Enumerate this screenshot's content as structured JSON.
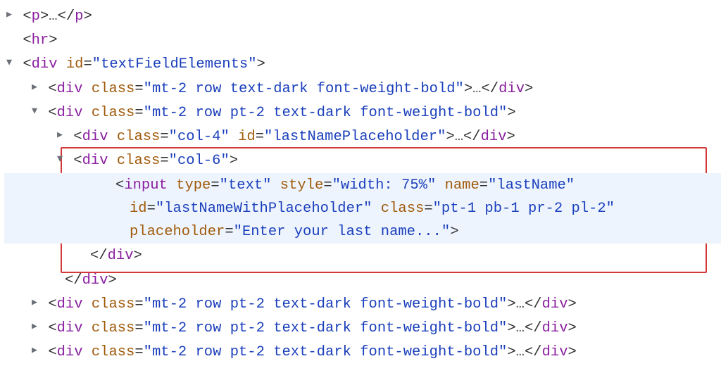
{
  "glyphs": {
    "right": "▸",
    "down": "▾",
    "ellipsis": "…"
  },
  "punct": {
    "lt": "<",
    "gt": ">",
    "close": "</",
    "eq": "="
  },
  "lines": {
    "l1": {
      "tag": "p"
    },
    "l2": {
      "tag": "hr"
    },
    "l3": {
      "tag": "div",
      "attrs": [
        {
          "name": "id",
          "value": "\"textFieldElements\""
        }
      ]
    },
    "l4": {
      "tag": "div",
      "attrs": [
        {
          "name": "class",
          "value": "\"mt-2 row text-dark font-weight-bold\""
        }
      ]
    },
    "l5": {
      "tag": "div",
      "attrs": [
        {
          "name": "class",
          "value": "\"mt-2 row pt-2 text-dark font-weight-bold\""
        }
      ]
    },
    "l6": {
      "tag": "div",
      "attrs": [
        {
          "name": "class",
          "value": "\"col-4\""
        },
        {
          "name": "id",
          "value": "\"lastNamePlaceholder\""
        }
      ]
    },
    "l7": {
      "tag": "div",
      "attrs": [
        {
          "name": "class",
          "value": "\"col-6\""
        }
      ]
    },
    "l8a": {
      "tag": "input",
      "a1": {
        "name": "type",
        "value": "\"text\""
      },
      "a2": {
        "name": "style",
        "value": "\"width: 75%\""
      },
      "a3": {
        "name": "name",
        "value": "\"lastName\""
      }
    },
    "l8b": {
      "a1": {
        "name": "id",
        "value": "\"lastNameWithPlaceholder\""
      },
      "a2": {
        "name": "class",
        "value": "\"pt-1 pb-1 pr-2 pl-2\""
      }
    },
    "l8c": {
      "a1": {
        "name": "placeholder",
        "value": "\"Enter your last name...\""
      }
    },
    "l9": {
      "tag": "div"
    },
    "l10": {
      "tag": "div"
    },
    "l11": {
      "tag": "div",
      "attrs": [
        {
          "name": "class",
          "value": "\"mt-2 row pt-2 text-dark font-weight-bold\""
        }
      ]
    },
    "l12": {
      "tag": "div",
      "attrs": [
        {
          "name": "class",
          "value": "\"mt-2 row pt-2 text-dark font-weight-bold\""
        }
      ]
    },
    "l13": {
      "tag": "div",
      "attrs": [
        {
          "name": "class",
          "value": "\"mt-2 row pt-2 text-dark font-weight-bold\""
        }
      ]
    }
  }
}
